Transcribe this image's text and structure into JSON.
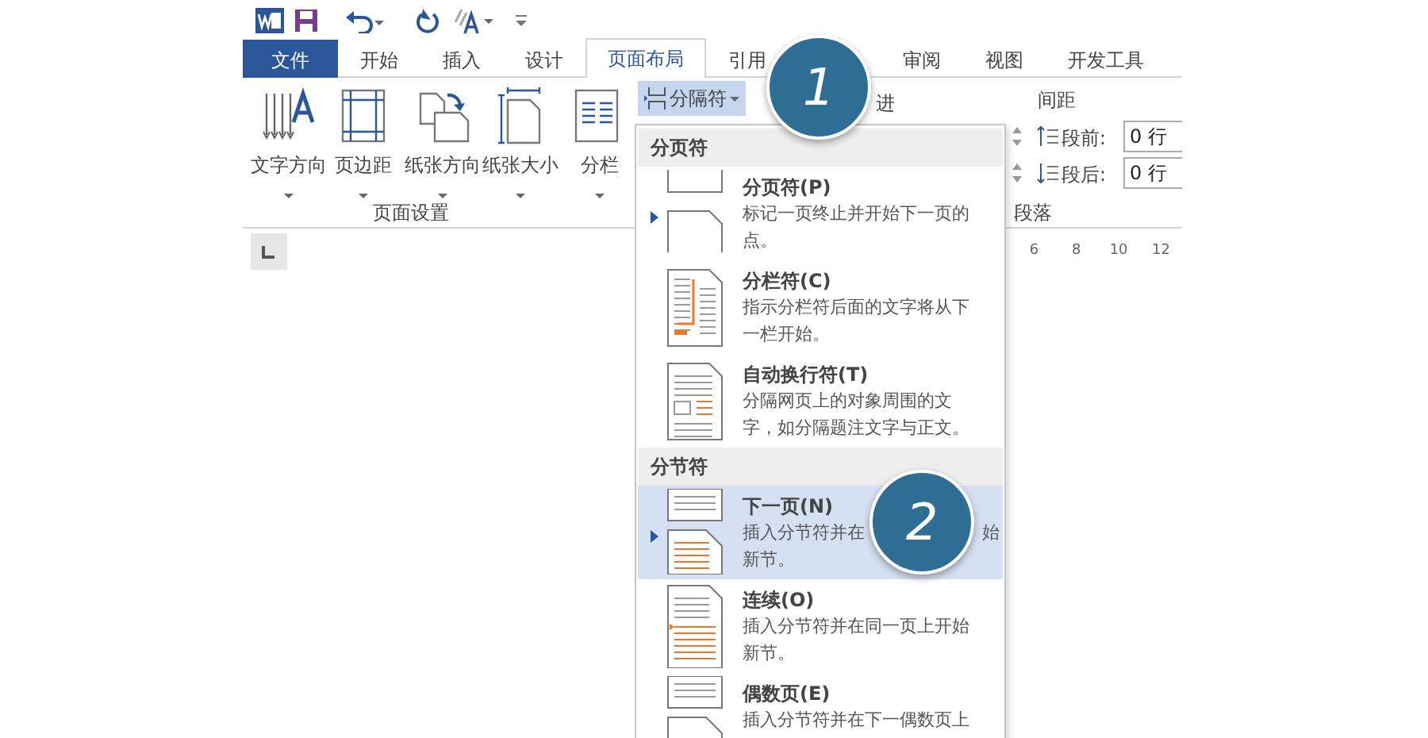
{
  "tabs": [
    {
      "label": "文件",
      "kind": "file",
      "selected": false
    },
    {
      "label": "开始",
      "kind": "tab",
      "selected": false
    },
    {
      "label": "插入",
      "kind": "tab",
      "selected": false
    },
    {
      "label": "设计",
      "kind": "tab",
      "selected": false
    },
    {
      "label": "页面布局",
      "kind": "tab",
      "selected": true
    },
    {
      "label": "引用",
      "kind": "tab",
      "selected": false
    },
    {
      "label": "审阅",
      "kind": "tab",
      "selected": false
    },
    {
      "label": "视图",
      "kind": "tab",
      "selected": false
    },
    {
      "label": "开发工具",
      "kind": "tab",
      "selected": false
    }
  ],
  "page_setup": {
    "label": "页面设置",
    "buttons": [
      {
        "label": "文字方向",
        "kind": "direction"
      },
      {
        "label": "页边距",
        "kind": "margins"
      },
      {
        "label": "纸张方向",
        "kind": "orientation"
      },
      {
        "label": "纸张大小",
        "kind": "size"
      },
      {
        "label": "分栏",
        "kind": "columns"
      }
    ]
  },
  "breaks_button": {
    "label": "分隔符",
    "expanded": true
  },
  "paragraph": {
    "label": "段落",
    "indent_header": "进",
    "spacing_header": "间距",
    "spacing": [
      {
        "label": "段前:",
        "value": "0 行",
        "kind": "before"
      },
      {
        "label": "段后:",
        "value": "0 行",
        "kind": "after"
      }
    ]
  },
  "ruler": {
    "numbers": [
      "6",
      "8",
      "10",
      "12"
    ]
  },
  "menu": {
    "sections": [
      {
        "title": "分页符",
        "items": [
          {
            "kind": "page",
            "title": "分页符(P)",
            "description": "标记一页终止并开始下一页的点。",
            "default": true,
            "selected": false
          },
          {
            "kind": "column",
            "title": "分栏符(C)",
            "description": "指示分栏符后面的文字将从下一栏开始。",
            "default": false,
            "selected": false
          },
          {
            "kind": "wrap",
            "title": "自动换行符(T)",
            "description": "分隔网页上的对象周围的文字，如分隔题注文字与正文。",
            "default": false,
            "selected": false
          }
        ]
      },
      {
        "title": "分节符",
        "items": [
          {
            "kind": "next",
            "title": "下一页(N)",
            "description_visible": [
              "插入分节符并在",
              "始",
              "新节。"
            ],
            "default": true,
            "selected": true
          },
          {
            "kind": "continuous",
            "title": "连续(O)",
            "description": "插入分节符并在同一页上开始新节。",
            "default": false,
            "selected": false
          },
          {
            "kind": "even",
            "title": "偶数页(E)",
            "description": "插入分节符并在下一偶数页上",
            "default": false,
            "selected": false
          }
        ]
      }
    ]
  },
  "callouts": [
    {
      "number": "1"
    },
    {
      "number": "2"
    }
  ]
}
